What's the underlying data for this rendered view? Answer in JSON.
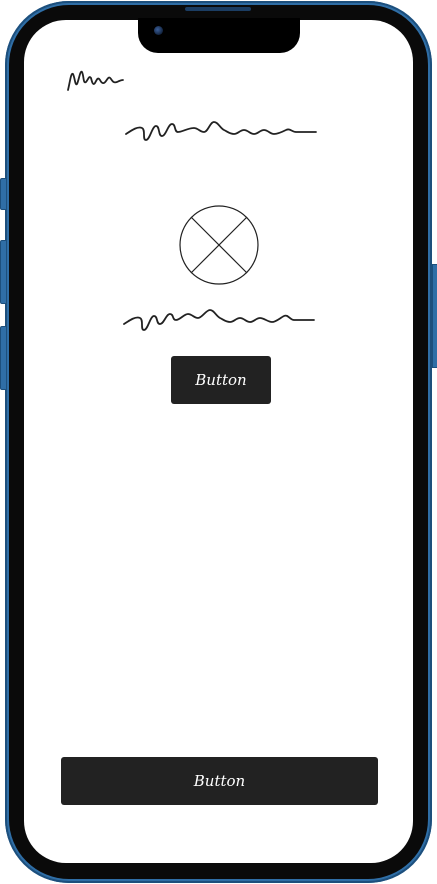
{
  "screen": {
    "primary_button_label": "Button",
    "footer_button_label": "Button"
  },
  "colors": {
    "frame": "#2f6ea6",
    "bezel": "#0a0a0a",
    "screen_bg": "#ffffff",
    "button_bg": "#222222",
    "button_text": "#ffffff",
    "sketch_stroke": "#222222"
  },
  "icons": {
    "image_placeholder": "image-placeholder-icon"
  }
}
